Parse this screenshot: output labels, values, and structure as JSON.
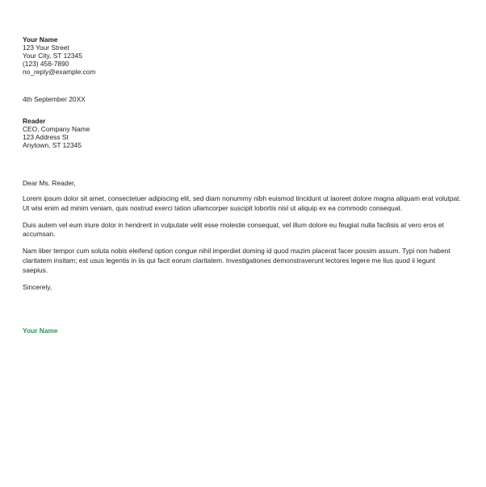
{
  "sender": {
    "name": "Your Name",
    "street": "123 Your Street",
    "city": "Your City, ST 12345",
    "phone": "(123) 456-7890",
    "email": "no_reply@example.com"
  },
  "date": "4th September 20XX",
  "recipient": {
    "name": "Reader",
    "title": "CEO, Company Name",
    "street": "123 Address St",
    "city": "Anytown, ST 12345"
  },
  "salutation": "Dear Ms. Reader,",
  "paragraphs": [
    "Lorem ipsum dolor sit amet, consectetuer adipiscing elit, sed diam nonummy nibh euismod tincidunt ut laoreet dolore magna aliquam erat volutpat. Ut wisi enim ad minim veniam, quis nostrud exerci tation ullamcorper suscipit lobortis nisl ut aliquip ex ea commodo consequat.",
    "Duis autem vel eum iriure dolor in hendrerit in vulputate velit esse molestie consequat, vel illum dolore eu feugiat nulla facilisis at vero eros et accumsan.",
    "Nam liber tempor cum soluta nobis eleifend option congue nihil imperdiet doming id quod mazim placerat facer possim assum. Typi non habent claritatem insitam; est usus legentis in iis qui facit eorum claritatem. Investigationes demonstraverunt lectores legere me lius quod ii legunt saepius."
  ],
  "closing": "Sincerely,",
  "signature": "Your Name",
  "colors": {
    "text": "#222222",
    "signature": "#1e9a4f",
    "background": "#ffffff"
  }
}
